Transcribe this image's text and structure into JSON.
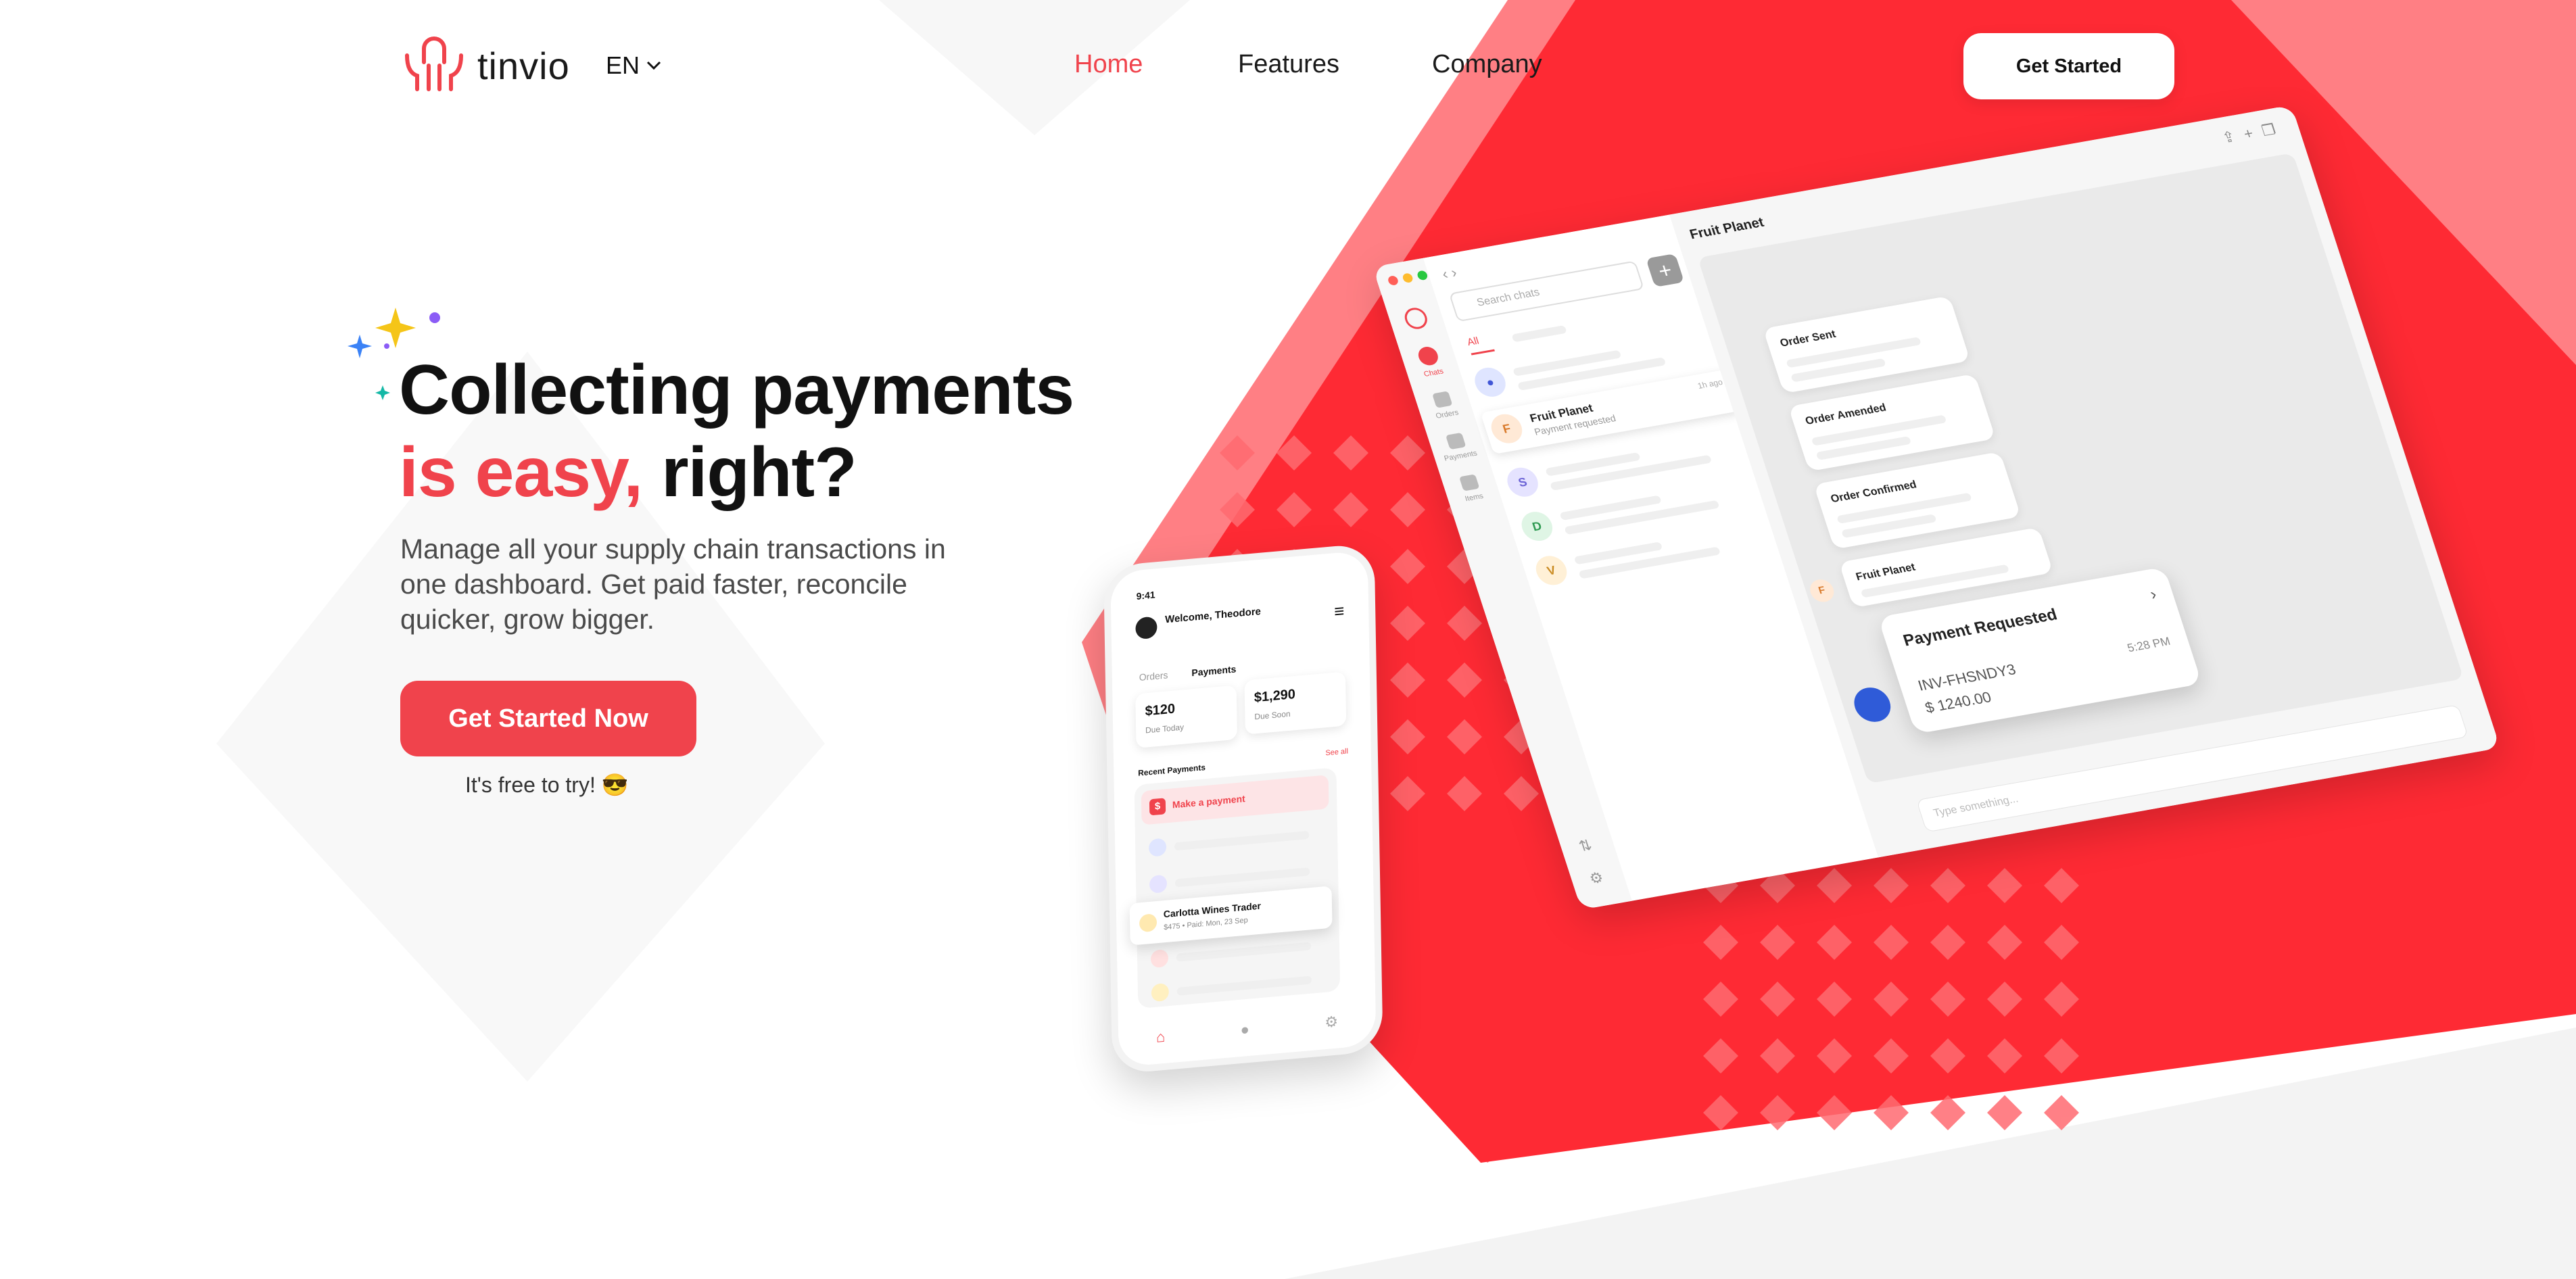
{
  "header": {
    "logo_text": "tinvio",
    "language": "EN",
    "nav": [
      {
        "label": "Home",
        "active": true
      },
      {
        "label": "Features",
        "active": false
      },
      {
        "label": "Company",
        "active": false
      }
    ],
    "cta_label": "Get Started"
  },
  "hero": {
    "line1": "Collecting payments",
    "line2_accent": "is easy,",
    "line2_rest": " right?",
    "description": "Manage all your supply chain transactions in one dashboard. Get paid faster, reconcile quicker, grow bigger.",
    "cta_label": "Get Started Now",
    "free_note": "It's free to try! 😎"
  },
  "desktop_mock": {
    "search_placeholder": "Search chats",
    "tab_all": "All",
    "sidebar": [
      "Chats",
      "Orders",
      "Payments",
      "Items"
    ],
    "chats": [
      {
        "initial": "",
        "name": "Fruit Planet",
        "sub": "Payment requested",
        "time": "1h ago"
      },
      {
        "initial": "F",
        "name": "",
        "sub": "",
        "time": ""
      },
      {
        "initial": "S",
        "name": "",
        "sub": "",
        "time": ""
      },
      {
        "initial": "D",
        "name": "",
        "sub": "",
        "time": ""
      },
      {
        "initial": "V",
        "name": "",
        "sub": "",
        "time": ""
      }
    ],
    "conversation_title": "Fruit Planet",
    "messages": [
      "Order Sent",
      "Order Amended",
      "Order Confirmed",
      "Fruit Planet"
    ],
    "sender_initial": "F",
    "payment_card": {
      "title": "Payment Requested",
      "invoice": "INV-FHSNDY3",
      "amount": "$ 1240.00",
      "time": "5:28 PM"
    },
    "input_placeholder": "Type something..."
  },
  "phone_mock": {
    "time": "9:41",
    "welcome": "Welcome, Theodore",
    "tabs": [
      "Orders",
      "Payments"
    ],
    "cards": [
      {
        "value": "$120",
        "sub": "Due Today"
      },
      {
        "value": "$1,290",
        "sub": "Due Soon"
      }
    ],
    "recent_label": "Recent Payments",
    "see_all": "See all",
    "make_payment": "Make a payment",
    "popup_title": "Carlotta Wines Trader",
    "popup_sub": "$475 • Paid: Mon, 23 Sep"
  },
  "colors": {
    "brand_red": "#f0434c",
    "bg_red": "#fe2a34",
    "bg_pink": "#ff7f84"
  }
}
